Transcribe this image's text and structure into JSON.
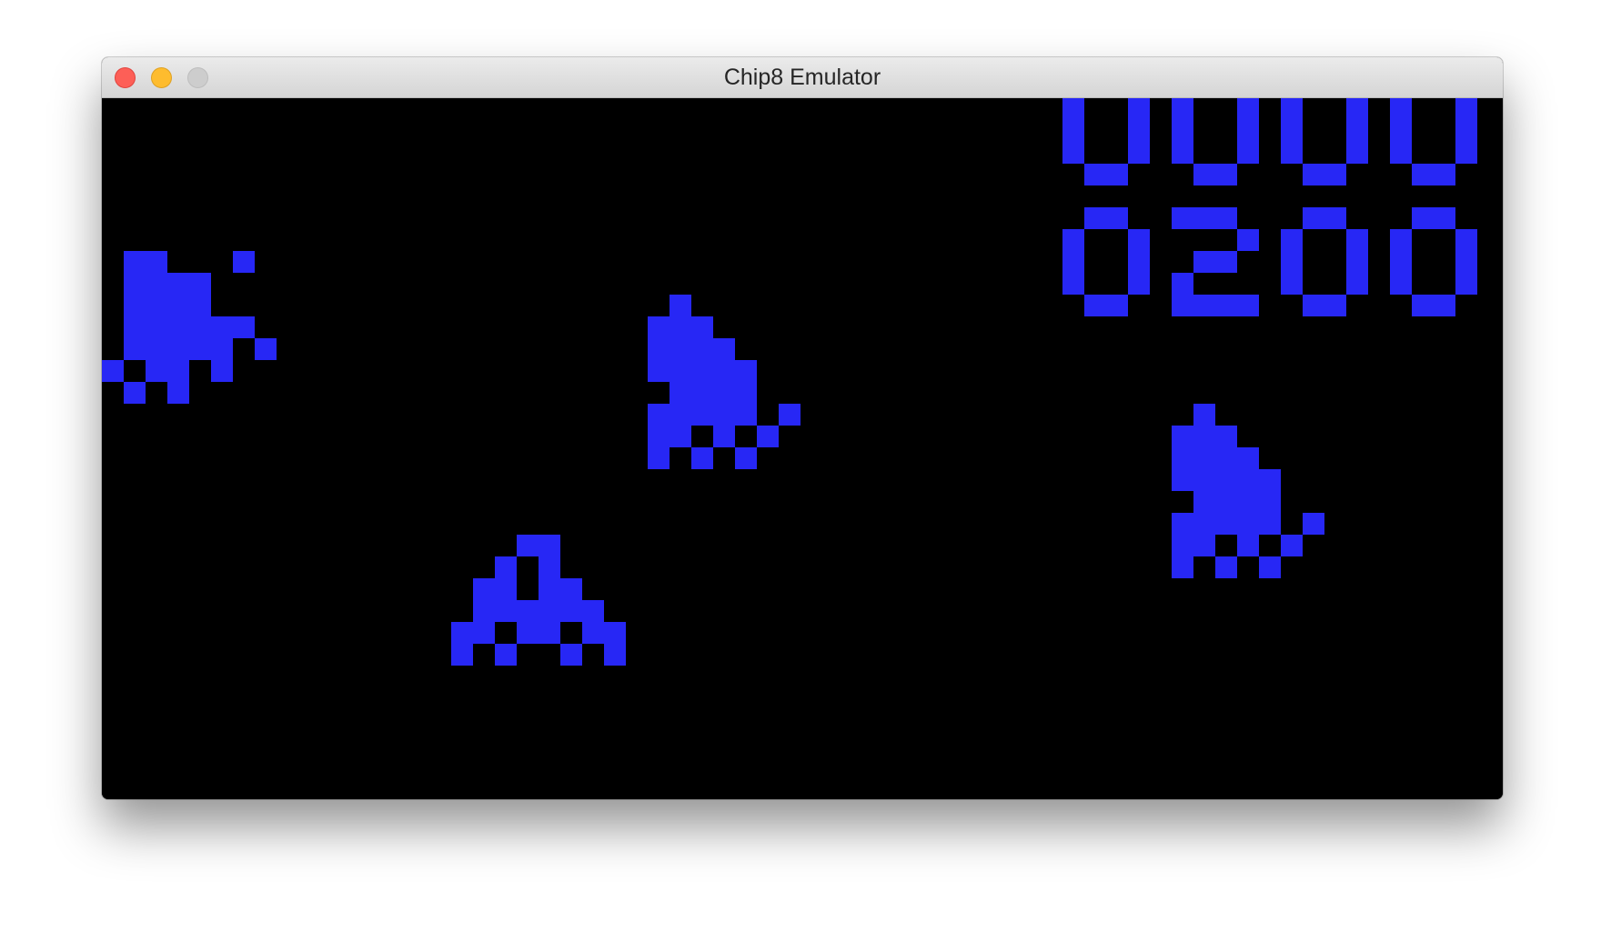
{
  "window": {
    "title": "Chip8 Emulator"
  },
  "display": {
    "foreground_color": "#2727f5",
    "background_color": "#000000",
    "score_rows": [
      "0000",
      "0200"
    ]
  },
  "sprites": [
    "alien-left",
    "alien-center",
    "alien-right",
    "player-ship"
  ]
}
